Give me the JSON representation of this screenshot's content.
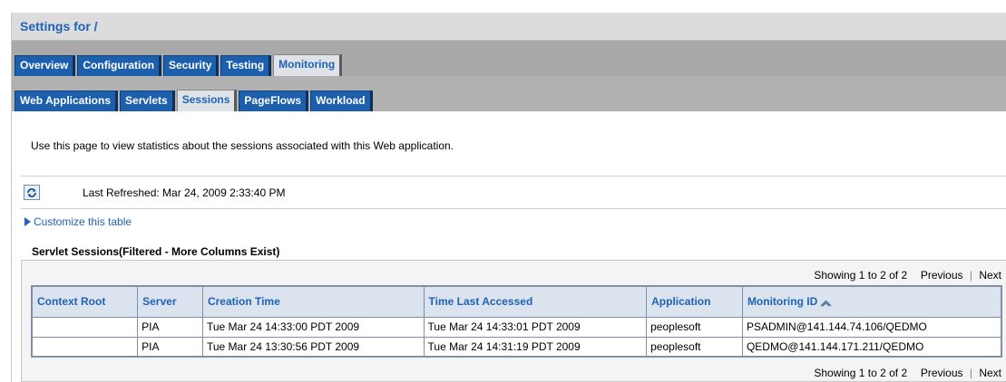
{
  "header": {
    "title": "Settings for /"
  },
  "tabs_primary": [
    {
      "label": "Overview"
    },
    {
      "label": "Configuration"
    },
    {
      "label": "Security"
    },
    {
      "label": "Testing"
    },
    {
      "label": "Monitoring"
    }
  ],
  "tabs_secondary": [
    {
      "label": "Web Applications"
    },
    {
      "label": "Servlets"
    },
    {
      "label": "Sessions"
    },
    {
      "label": "PageFlows"
    },
    {
      "label": "Workload"
    }
  ],
  "intro_text": "Use this page to view statistics about the sessions associated with this Web application.",
  "refresh": {
    "last_refreshed": "Last Refreshed: Mar 24, 2009 2:33:40 PM"
  },
  "customize_link": "Customize this table",
  "table": {
    "title": "Servlet Sessions(Filtered - More Columns Exist)",
    "pager": {
      "showing": "Showing 1 to 2 of 2",
      "previous": "Previous",
      "separator": "|",
      "next": "Next"
    },
    "columns": [
      "Context Root",
      "Server",
      "Creation Time",
      "Time Last Accessed",
      "Application",
      "Monitoring ID"
    ],
    "rows": [
      [
        "",
        "PIA",
        "Tue Mar 24 14:33:00 PDT 2009",
        "Tue Mar 24 14:33:01 PDT 2009",
        "peoplesoft",
        "PSADMIN@141.144.74.106/QEDMO"
      ],
      [
        "",
        "PIA",
        "Tue Mar 24 13:30:56 PDT 2009",
        "Tue Mar 24 14:31:19 PDT 2009",
        "peoplesoft",
        "QEDMO@141.144.171.211/QEDMO"
      ]
    ]
  },
  "colors": {
    "link_blue": "#1e63b5",
    "tab_blue": "#1c5fac",
    "header_row": "#dae3ee"
  },
  "icons": {
    "refresh": "refresh-icon",
    "customize": "triangle-right-icon",
    "sort": "sort-ascending-icon"
  }
}
